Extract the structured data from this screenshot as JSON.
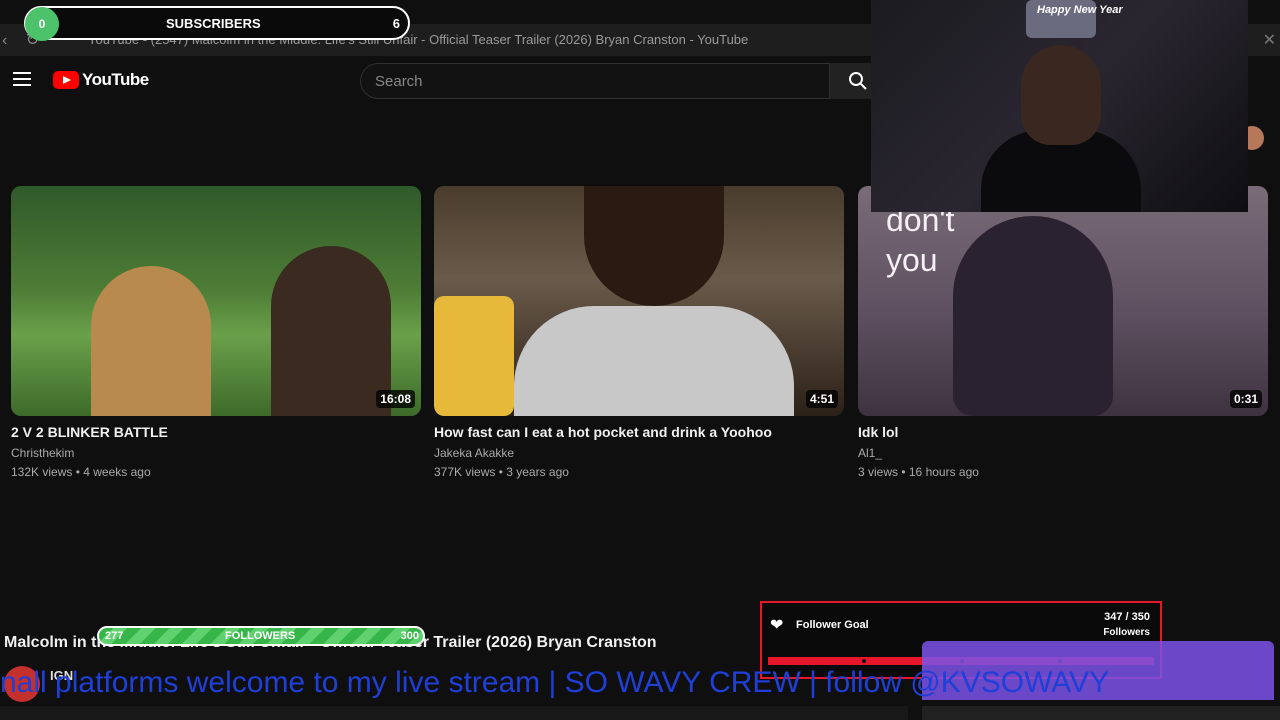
{
  "browser": {
    "tab_title": "YouTube - (2547) Malcolm in the Middle: Life's Still Unfair - Official Teaser Trailer (2026) Bryan Cranston - YouTube"
  },
  "header": {
    "logo_text": "YouTube",
    "search_placeholder": "Search"
  },
  "videos": [
    {
      "title": "2 V 2 BLINKER BATTLE",
      "channel": "Christhekim",
      "meta": "132K views • 4 weeks ago",
      "duration": "16:08"
    },
    {
      "title": "How fast can I eat a hot pocket and drink a Yoohoo",
      "channel": "Jakeka Akakke",
      "meta": "377K views • 3 years ago",
      "duration": "4:51"
    },
    {
      "title": "Idk lol",
      "channel": "Al1_",
      "meta": "3 views • 16 hours ago",
      "duration": "0:31",
      "thumb_text_1": "don't",
      "thumb_text_2": "you"
    }
  ],
  "overlay": {
    "subscribers": {
      "label": "SUBSCRIBERS",
      "start": "0",
      "end": "6"
    },
    "followers_bar": {
      "label": "FOLLOWERS",
      "start": "277",
      "end": "300"
    },
    "follower_goal": {
      "label": "Follower Goal",
      "count": "347 / 350",
      "unit": "Followers",
      "progress": 0.9914
    },
    "webcam_hat_text": "Happy New Year",
    "marquee": "nall platforms welcome to my live stream | SO WAVY CREW | follow @KVSOWAVY"
  },
  "now_playing": {
    "title": "Malcolm in the Middle: Life's Still Unfair - Official Teaser Trailer (2026) Bryan Cranston",
    "channel": "IGN"
  },
  "colors": {
    "yt_red": "#ff0000",
    "goal_red": "#e8162a",
    "follower_green": "#36b548",
    "marquee_blue": "#1f3fd8",
    "purple": "#7a52e8"
  }
}
